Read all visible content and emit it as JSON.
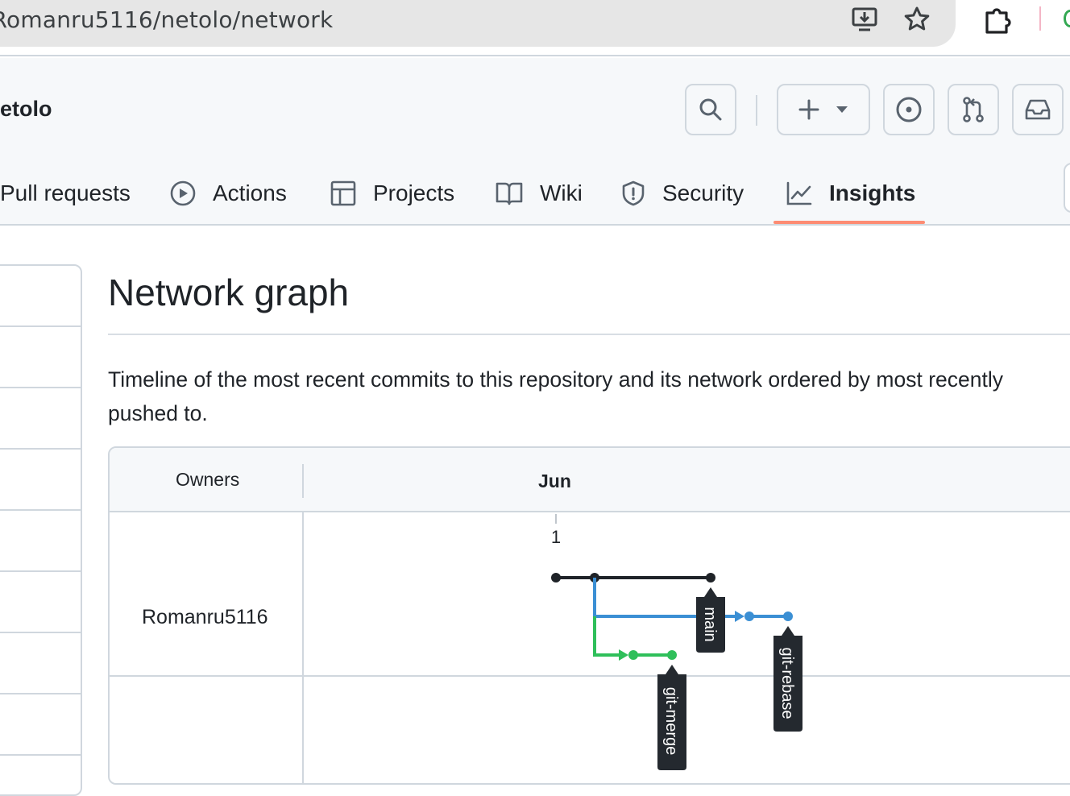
{
  "browser": {
    "url": "/Romanru5116/netolo/network"
  },
  "repo": {
    "name": "etolo"
  },
  "nav": {
    "pull_requests": "Pull requests",
    "actions": "Actions",
    "projects": "Projects",
    "wiki": "Wiki",
    "security": "Security",
    "insights": "Insights"
  },
  "page": {
    "title": "Network graph",
    "description": "Timeline of the most recent commits to this repository and its network ordered by most recently pushed to."
  },
  "graph": {
    "owners_header": "Owners",
    "month": "Jun",
    "day": "1",
    "owner": "Romanru5116",
    "branches": [
      "main",
      "git-rebase",
      "git-merge"
    ],
    "colors": {
      "main": "#1f2328",
      "git-rebase": "#3b8fd4",
      "git-merge": "#2fbf5a"
    }
  }
}
